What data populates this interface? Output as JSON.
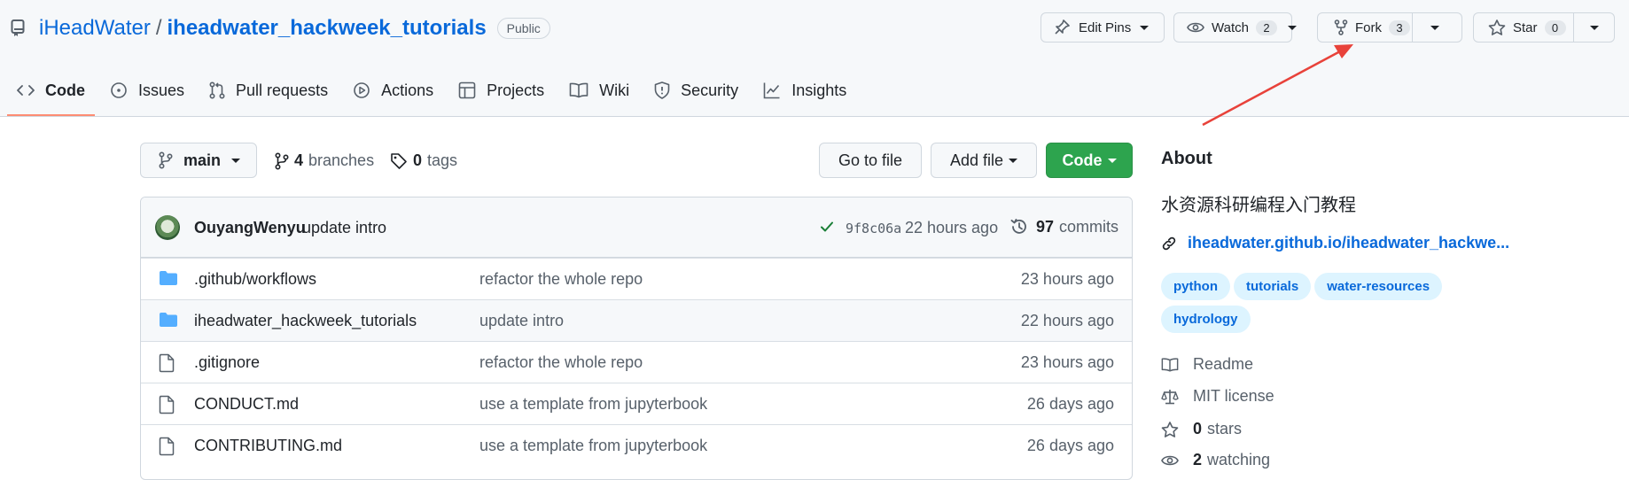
{
  "repo": {
    "owner": "iHeadWater",
    "separator": "/",
    "name": "iheadwater_hackweek_tutorials",
    "visibility": "Public"
  },
  "header_actions": {
    "edit_pins": "Edit Pins",
    "watch": {
      "label": "Watch",
      "count": "2"
    },
    "fork": {
      "label": "Fork",
      "count": "3"
    },
    "star": {
      "label": "Star",
      "count": "0"
    }
  },
  "tabs": [
    {
      "label": "Code",
      "icon": "code-icon",
      "active": true
    },
    {
      "label": "Issues",
      "icon": "issue-icon"
    },
    {
      "label": "Pull requests",
      "icon": "pull-request-icon"
    },
    {
      "label": "Actions",
      "icon": "play-icon"
    },
    {
      "label": "Projects",
      "icon": "table-icon"
    },
    {
      "label": "Wiki",
      "icon": "book-icon"
    },
    {
      "label": "Security",
      "icon": "shield-icon"
    },
    {
      "label": "Insights",
      "icon": "graph-icon"
    }
  ],
  "file_nav": {
    "branch": "main",
    "branches_count": "4",
    "branches_label": "branches",
    "tags_count": "0",
    "tags_label": "tags",
    "go_to_file": "Go to file",
    "add_file": "Add file",
    "code": "Code"
  },
  "latest_commit": {
    "author": "OuyangWenyu",
    "message": "update intro",
    "sha": "9f8c06a",
    "time": "22 hours ago",
    "commits_count": "97",
    "commits_label": "commits"
  },
  "files": [
    {
      "type": "folder",
      "name": ".github/workflows",
      "commit": "refactor the whole repo",
      "age": "23 hours ago"
    },
    {
      "type": "folder",
      "name": "iheadwater_hackweek_tutorials",
      "commit": "update intro",
      "age": "22 hours ago"
    },
    {
      "type": "file",
      "name": ".gitignore",
      "commit": "refactor the whole repo",
      "age": "23 hours ago"
    },
    {
      "type": "file",
      "name": "CONDUCT.md",
      "commit": "use a template from jupyterbook",
      "age": "26 days ago"
    },
    {
      "type": "file",
      "name": "CONTRIBUTING.md",
      "commit": "use a template from jupyterbook",
      "age": "26 days ago"
    }
  ],
  "about": {
    "title": "About",
    "description": "水资源科研编程入门教程",
    "link": "iheadwater.github.io/iheadwater_hackwe...",
    "topics": [
      "python",
      "tutorials",
      "water-resources",
      "hydrology"
    ],
    "readme": "Readme",
    "license": "MIT license",
    "stars_count": "0",
    "stars_label": "stars",
    "watching_count": "2",
    "watching_label": "watching"
  },
  "colors": {
    "link": "#0969da",
    "primary_button": "#2da44e",
    "active_tab_underline": "#fd8c73",
    "annotation_arrow": "#e8423a",
    "topic_bg": "#ddf4ff"
  }
}
